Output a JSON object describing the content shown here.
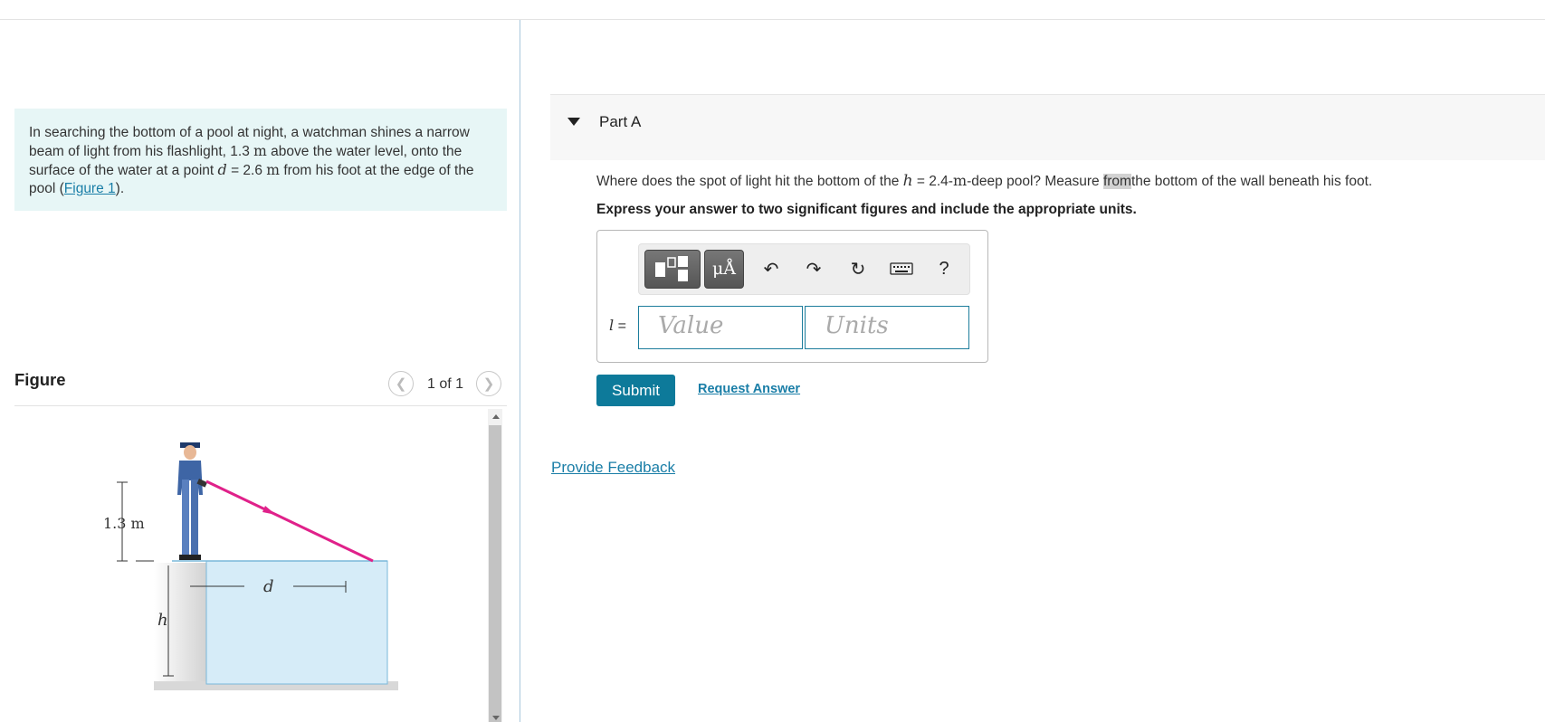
{
  "problem": {
    "text_1": "In searching the bottom of a pool at night, a watchman shines a narrow beam of light from his flashlight, 1.3",
    "unit_m_1": "m",
    "text_2": "above the water level, onto the surface of the water at a point",
    "var_d": "d",
    "text_3": "= 2.6",
    "unit_m_2": "m",
    "text_4": "from his foot at the edge of the pool (",
    "figure_link": "Figure 1",
    "text_5": ")."
  },
  "figure": {
    "title": "Figure",
    "pager": "1 of 1",
    "label_height": "1.3 m",
    "label_d": "d",
    "label_h": "h"
  },
  "part": {
    "title": "Part A",
    "question_1": "Where does the spot of light hit the bottom of the",
    "var_h": "h",
    "question_2": "= 2.4-",
    "unit_m": "m",
    "question_3": "-deep pool? Measure",
    "highlight": "from",
    "question_4": "the bottom of the wall beneath his foot.",
    "instruction": "Express your answer to two significant figures and include the appropriate units."
  },
  "toolbar": {
    "mu_label": "μÅ",
    "help_label": "?"
  },
  "answer": {
    "variable": "l",
    "eq": "=",
    "value_placeholder": "Value",
    "units_placeholder": "Units"
  },
  "actions": {
    "submit": "Submit",
    "request_answer": "Request Answer",
    "provide_feedback": "Provide Feedback"
  },
  "colors": {
    "accent": "#0d7a9a",
    "link": "#1a7ea7",
    "problem_bg": "#e7f6f6",
    "beam": "#e0218a",
    "water": "#d6ecf8"
  }
}
